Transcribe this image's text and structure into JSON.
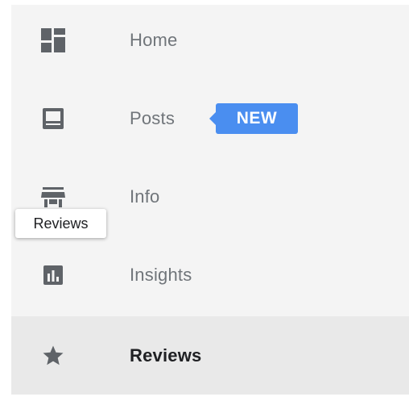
{
  "nav": {
    "items": [
      {
        "label": "Home",
        "icon": "dashboard-icon"
      },
      {
        "label": "Posts",
        "icon": "posts-icon",
        "badge": "NEW"
      },
      {
        "label": "Info",
        "icon": "storefront-icon"
      },
      {
        "label": "Insights",
        "icon": "insights-icon"
      },
      {
        "label": "Reviews",
        "icon": "star-icon",
        "active": true
      }
    ]
  },
  "tooltip": {
    "text": "Reviews"
  },
  "colors": {
    "sidebar_bg": "#f4f4f4",
    "active_bg": "#e9e9e9",
    "badge_bg": "#4a8ef0",
    "icon": "#5f6368",
    "label": "#70757a"
  }
}
